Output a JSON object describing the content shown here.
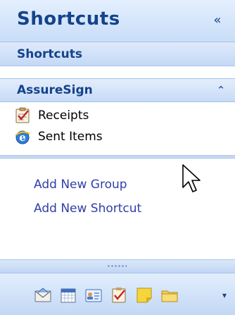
{
  "header": {
    "title": "Shortcuts",
    "collapse_glyph": "«"
  },
  "subheader": {
    "label": "Shortcuts"
  },
  "group": {
    "label": "AssureSign",
    "toggle_glyph": "⌃",
    "items": [
      {
        "label": "Receipts",
        "icon": "task-icon"
      },
      {
        "label": "Sent Items",
        "icon": "internet-explorer-icon"
      }
    ]
  },
  "links": {
    "add_group": "Add New Group",
    "add_shortcut": "Add New Shortcut"
  },
  "toolbar": {
    "icons": [
      "mail-icon",
      "calendar-icon",
      "contacts-icon",
      "tasks-icon",
      "notes-icon",
      "folder-icon"
    ],
    "dropdown_glyph": "▾"
  },
  "colors": {
    "header_text": "#15428b",
    "link_text": "#2f3fa8",
    "pane_border": "#a6c2e8"
  }
}
